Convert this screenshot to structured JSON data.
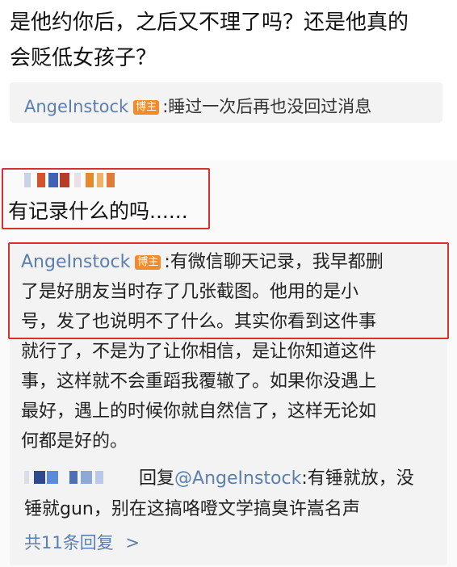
{
  "post": {
    "question_line1": "是他约你后，之后又不理了吗？还是他真的",
    "question_line2": "会贬低女孩子？"
  },
  "reply_1": {
    "author": "AngeInstock",
    "badge": "博主",
    "text": ":睡过一次后再也没回过消息"
  },
  "comment": {
    "text": "有记录什么的吗......"
  },
  "reply_2": {
    "author": "AngeInstock",
    "badge": "博主",
    "line1": ":有微信聊天记录，我早都删",
    "line2": "了是好朋友当时存了几张截图。他用的是小",
    "line3": "号，发了也说明不了什么。其实你看到这件事",
    "line4": "就行了，不是为了让你相信，是让你知道这件",
    "line5": "事，这样就不会重蹈我覆辙了。如果你没遇上",
    "line6": "最好，遇上的时候你就自然信了，这样无论如",
    "line7": "何都是好的。"
  },
  "sub_reply": {
    "action": "回复",
    "mention": "@AngeInstock",
    "text_1": ":有锤就放，没",
    "text_2": "锤就gun，别在这搞咯噔文学搞臭许嵩名声"
  },
  "more_replies": {
    "label": "共11条回复",
    "arrow": ">"
  },
  "colors": {
    "link_blue": "#5b7fae",
    "highlight_red": "#d9302c",
    "badge_orange": "#f58a2a",
    "reply_bg": "#f3f3f3"
  }
}
